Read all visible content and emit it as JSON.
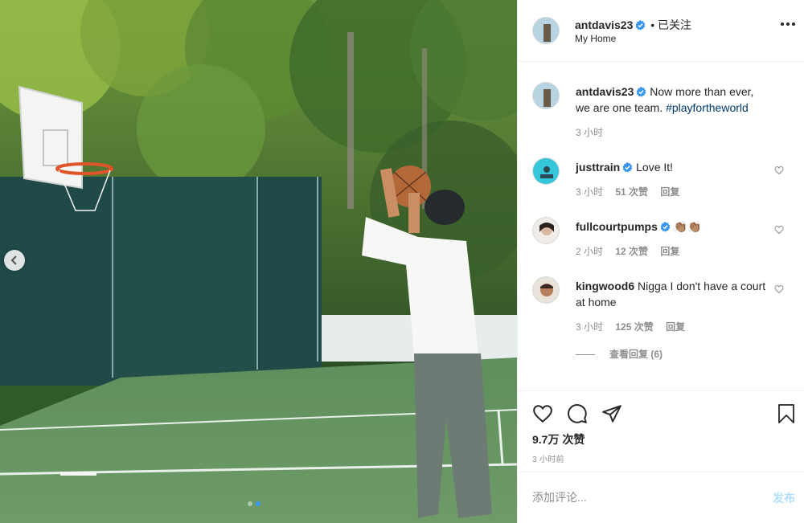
{
  "post": {
    "author": "antdavis23",
    "follow_status": "• 已关注",
    "location": "My Home",
    "caption": {
      "text": "Now more than ever, we are one team.",
      "hashtag": "#playfortheworld",
      "time": "3 小时"
    },
    "likes": "9.7万 次赞",
    "posted_ago": "3 小时前",
    "comment_placeholder": "添加评论...",
    "post_label": "发布",
    "carousel_dots": 2,
    "carousel_active": 2
  },
  "comments": [
    {
      "user": "justtrain",
      "verified": true,
      "text": "Love It!",
      "time": "3 小时",
      "likes": "51 次赞",
      "reply": "回复"
    },
    {
      "user": "fullcourtpumps",
      "verified": true,
      "text": "👏🏽👏🏽",
      "time": "2 小时",
      "likes": "12 次赞",
      "reply": "回复"
    },
    {
      "user": "kingwood6",
      "verified": false,
      "text": "Nigga I don't have a court at home",
      "time": "3 小时",
      "likes": "125 次赞",
      "reply": "回复",
      "view_replies": "查看回复 (6)"
    }
  ],
  "colors": {
    "verified": "#3897f0",
    "hashtag": "#00376b",
    "meta_gray": "#8e8e8e",
    "post_btn_disabled": "#b2dffc",
    "court_green": "#4f7f53"
  },
  "icons": [
    "verified-badge-icon",
    "more-options-icon",
    "heart-icon",
    "comment-icon",
    "share-icon",
    "bookmark-icon",
    "chevron-left-icon"
  ]
}
